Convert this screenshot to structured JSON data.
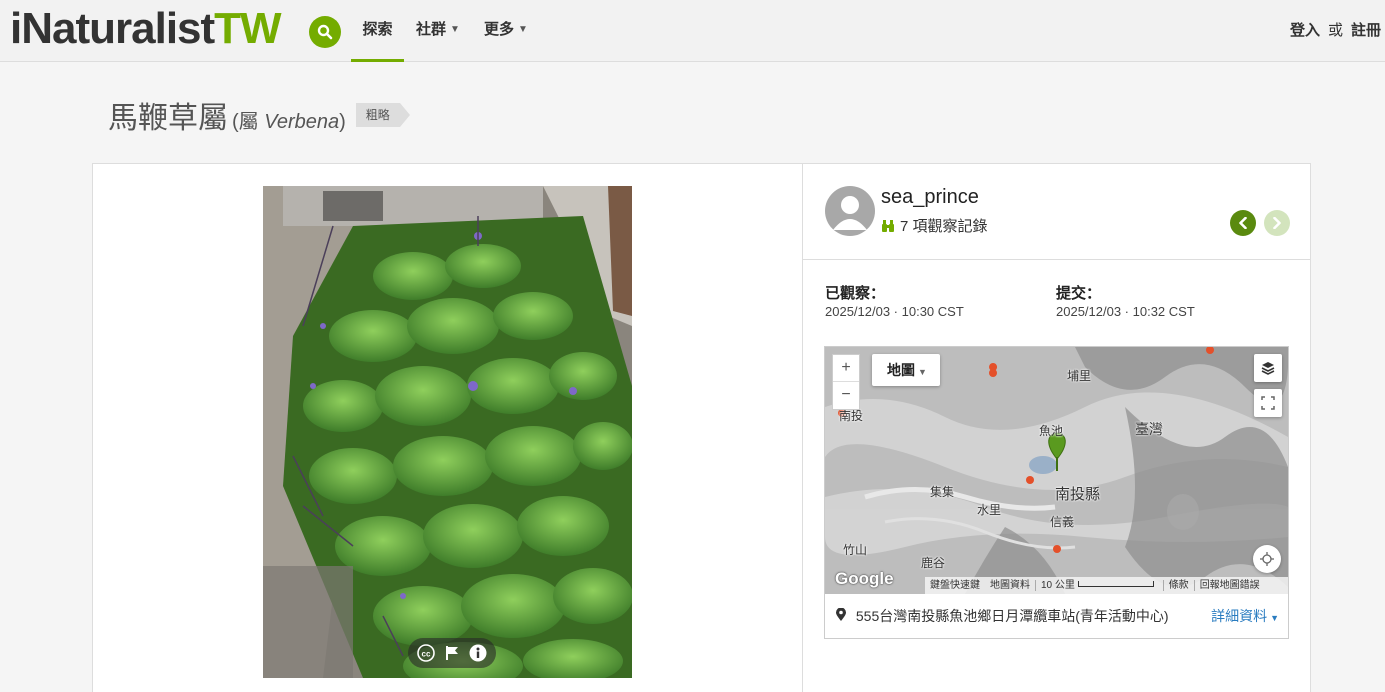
{
  "header": {
    "logo_part1": "iNaturalist",
    "logo_part2": "TW",
    "search_icon": "search-icon",
    "nav": [
      {
        "label": "探索",
        "active": true
      },
      {
        "label": "社群",
        "has_dropdown": true
      },
      {
        "label": "更多",
        "has_dropdown": true
      }
    ],
    "login": "登入",
    "or": "或",
    "signup": "註冊"
  },
  "taxon": {
    "common_name": "馬鞭草屬",
    "rank_prefix": "(屬 ",
    "scientific_name": "Verbena",
    "rank_suffix": ")",
    "quality_badge": "粗略"
  },
  "observation": {
    "photo_controls": [
      "cc-license-icon",
      "flag-icon",
      "info-icon"
    ],
    "user": {
      "username": "sea_prince",
      "obs_count": "7 項觀察記錄",
      "obs_icon": "binoculars-icon"
    },
    "nav": {
      "prev_icon": "chevron-left-icon",
      "next_icon": "chevron-right-icon"
    },
    "observed_label": "已觀察：",
    "observed_value": "2025/12/03 · 10:30 CST",
    "submitted_label": "提交：",
    "submitted_value": "2025/12/03 · 10:32 CST"
  },
  "map": {
    "zoom_in": "+",
    "zoom_out": "−",
    "map_type": "地圖",
    "layers_icon": "layers-icon",
    "fullscreen_icon": "fullscreen-icon",
    "locate_icon": "locate-icon",
    "google_logo": "Google",
    "labels": [
      "埔里",
      "魚池",
      "南投縣",
      "集集",
      "水里",
      "信義",
      "竹山",
      "鹿谷",
      "南投",
      "臺灣"
    ],
    "attribution": {
      "shortcuts": "鍵盤快速鍵",
      "map_data": "地圖資料",
      "scale": "10 公里",
      "terms": "條款",
      "report": "回報地圖錯誤"
    },
    "place": "555台灣南投縣魚池鄉日月潭纜車站(青年活動中心)",
    "details": "詳細資料"
  },
  "colors": {
    "brand_green": "#74ac00",
    "dark_green": "#5a8a0f",
    "link_blue": "#2a7cc0"
  }
}
